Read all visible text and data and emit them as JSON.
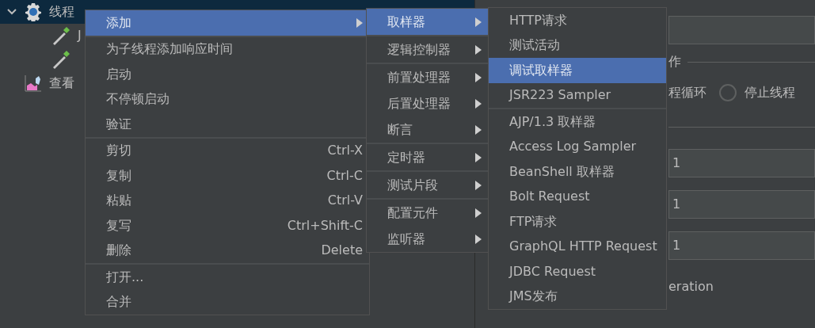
{
  "tree": {
    "items": [
      {
        "label": "线程",
        "kind": "gear",
        "selected": true,
        "expanded": true,
        "children": [
          {
            "label": "J",
            "kind": "pipette"
          },
          {
            "kind": "pipette"
          }
        ]
      },
      {
        "label": "查看",
        "kind": "chart",
        "selected": false
      }
    ]
  },
  "right_panel": {
    "group_title": "作",
    "options": [
      {
        "label": "程循环",
        "kind": "text"
      },
      {
        "label": "停止线程",
        "kind": "radio",
        "selected": false
      }
    ],
    "fields": [
      {
        "value": "1"
      },
      {
        "value": "1"
      },
      {
        "value": "1"
      }
    ],
    "note": "eration"
  },
  "context_menu": {
    "groups": [
      [
        {
          "label": "添加",
          "submenu": true,
          "selected": true
        }
      ],
      [
        {
          "label": "为子线程添加响应时间",
          "selected": false
        },
        {
          "label": "启动",
          "selected": false
        },
        {
          "label": "不停顿启动",
          "selected": false
        },
        {
          "label": "验证",
          "selected": false
        }
      ],
      [
        {
          "label": "剪切",
          "shortcut": "Ctrl-X",
          "selected": false
        },
        {
          "label": "复制",
          "shortcut": "Ctrl-C",
          "selected": false
        },
        {
          "label": "粘贴",
          "shortcut": "Ctrl-V",
          "selected": false
        },
        {
          "label": "复写",
          "shortcut": "Ctrl+Shift-C",
          "selected": false
        },
        {
          "label": "删除",
          "shortcut": "Delete",
          "selected": false
        }
      ],
      [
        {
          "label": "打开...",
          "selected": false
        },
        {
          "label": "合并",
          "selected": false
        }
      ]
    ]
  },
  "submenu": {
    "groups": [
      [
        {
          "label": "取样器",
          "submenu": true,
          "selected": true
        }
      ],
      [
        {
          "label": "逻辑控制器",
          "submenu": true,
          "selected": false
        }
      ],
      [
        {
          "label": "前置处理器",
          "submenu": true,
          "selected": false
        },
        {
          "label": "后置处理器",
          "submenu": true,
          "selected": false
        },
        {
          "label": "断言",
          "submenu": true,
          "selected": false
        }
      ],
      [
        {
          "label": "定时器",
          "submenu": true,
          "selected": false
        }
      ],
      [
        {
          "label": "测试片段",
          "submenu": true,
          "selected": false
        }
      ],
      [
        {
          "label": "配置元件",
          "submenu": true,
          "selected": false
        },
        {
          "label": "监听器",
          "submenu": true,
          "selected": false
        }
      ]
    ]
  },
  "sampler_menu": {
    "groups": [
      [
        {
          "label": "HTTP请求",
          "selected": false
        },
        {
          "label": "测试活动",
          "selected": false
        },
        {
          "label": "调试取样器",
          "selected": true
        },
        {
          "label": "JSR223 Sampler",
          "selected": false
        }
      ],
      [
        {
          "label": "AJP/1.3 取样器",
          "selected": false
        },
        {
          "label": "Access Log Sampler",
          "selected": false
        },
        {
          "label": "BeanShell 取样器",
          "selected": false
        },
        {
          "label": "Bolt Request",
          "selected": false
        },
        {
          "label": "FTP请求",
          "selected": false
        },
        {
          "label": "GraphQL HTTP Request",
          "selected": false
        },
        {
          "label": "JDBC Request",
          "selected": false
        },
        {
          "label": "JMS发布",
          "selected": false
        }
      ]
    ]
  }
}
